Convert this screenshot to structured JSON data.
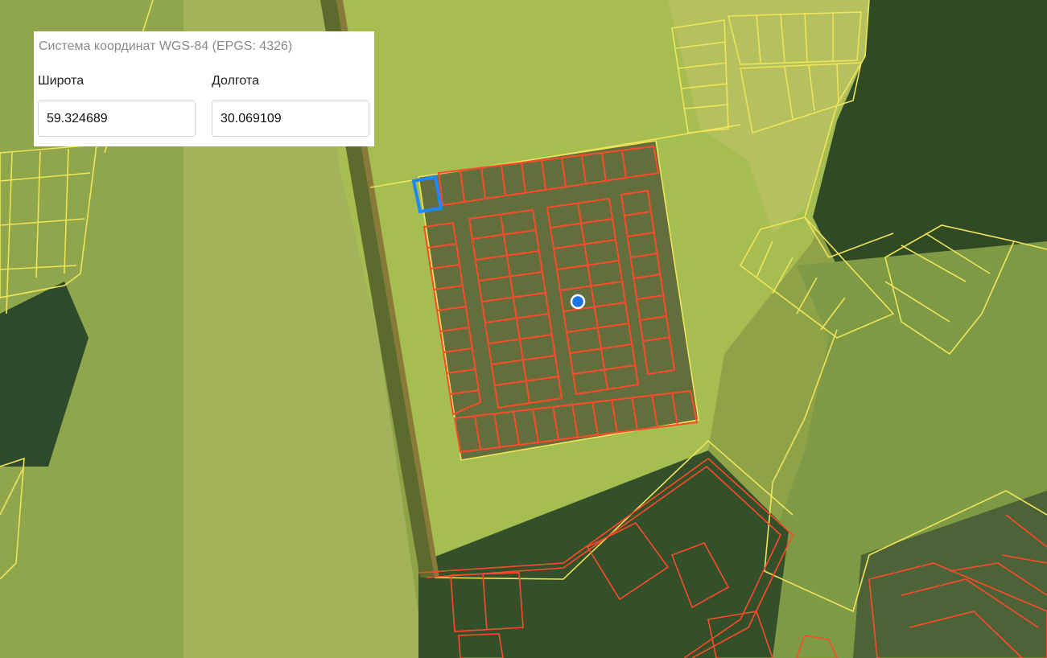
{
  "coordinate_panel": {
    "title": "Система координат WGS-84 (EPGS: 4326)",
    "latitude": {
      "label": "Широта",
      "value": "59.324689"
    },
    "longitude": {
      "label": "Долгота",
      "value": "30.069109"
    }
  },
  "map": {
    "type": "satellite cadastral map",
    "parcel_outline_colors": {
      "yellow": "#efe45a",
      "red": "#ff4a2a",
      "selected": "#1e88ff"
    },
    "location_marker_color": "#1a73e8"
  }
}
